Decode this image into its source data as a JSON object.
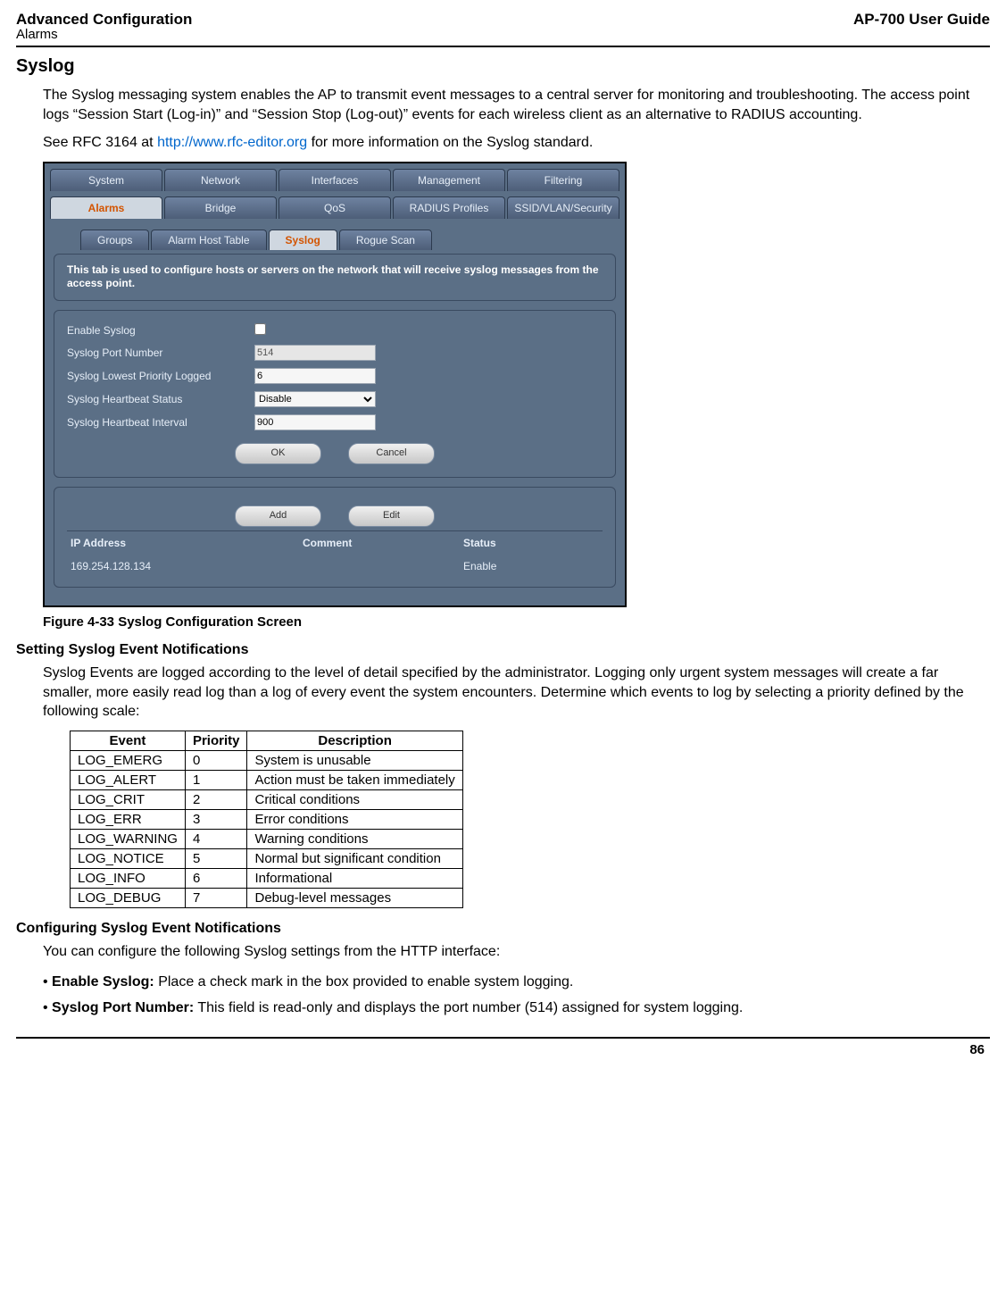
{
  "header": {
    "left_title": "Advanced Configuration",
    "left_sub": "Alarms",
    "right_title": "AP-700 User Guide"
  },
  "section_title": "Syslog",
  "intro_p1": "The Syslog messaging system enables the AP to transmit event messages to a central server for monitoring and troubleshooting. The access point logs “Session Start (Log-in)” and “Session Stop (Log-out)” events for each wireless client as an alternative to RADIUS accounting.",
  "intro_p2a": "See RFC 3164 at ",
  "intro_link": "http://www.rfc-editor.org",
  "intro_p2b": " for more information on the Syslog standard.",
  "ui": {
    "main_tabs": [
      "System",
      "Network",
      "Interfaces",
      "Management",
      "Filtering"
    ],
    "main_tabs2": [
      "Alarms",
      "Bridge",
      "QoS",
      "RADIUS Profiles",
      "SSID/VLAN/Security"
    ],
    "main_tabs2_active": 0,
    "sub_tabs": [
      "Groups",
      "Alarm Host Table",
      "Syslog",
      "Rogue Scan"
    ],
    "sub_tabs_active": 2,
    "panel_desc": "This tab is used to configure hosts or servers on the network that will receive syslog messages from the access point.",
    "form": {
      "enable_label": "Enable Syslog",
      "port_label": "Syslog Port Number",
      "port_value": "514",
      "priority_label": "Syslog Lowest Priority Logged",
      "priority_value": "6",
      "hb_status_label": "Syslog Heartbeat Status",
      "hb_status_value": "Disable",
      "hb_interval_label": "Syslog Heartbeat Interval",
      "hb_interval_value": "900"
    },
    "buttons": {
      "ok": "OK",
      "cancel": "Cancel",
      "add": "Add",
      "edit": "Edit"
    },
    "host_table": {
      "headers": {
        "ip": "IP Address",
        "comment": "Comment",
        "status": "Status"
      },
      "rows": [
        {
          "ip": "169.254.128.134",
          "comment": "",
          "status": "Enable"
        }
      ]
    }
  },
  "figure_caption": "Figure 4-33 Syslog Configuration Screen",
  "setting_title": "Setting Syslog Event Notifications",
  "setting_p": "Syslog Events are logged according to the level of detail specified by the administrator. Logging only urgent system messages will create a far smaller, more easily read log than a log of every event the system encounters. Determine which events to log by selecting a priority defined by the following scale:",
  "priority_table": {
    "headers": [
      "Event",
      "Priority",
      "Description"
    ],
    "rows": [
      [
        "LOG_EMERG",
        "0",
        "System is unusable"
      ],
      [
        "LOG_ALERT",
        "1",
        "Action must be taken immediately"
      ],
      [
        "LOG_CRIT",
        "2",
        "Critical conditions"
      ],
      [
        "LOG_ERR",
        "3",
        "Error conditions"
      ],
      [
        "LOG_WARNING",
        "4",
        "Warning conditions"
      ],
      [
        "LOG_NOTICE",
        "5",
        "Normal but significant condition"
      ],
      [
        "LOG_INFO",
        "6",
        "Informational"
      ],
      [
        "LOG_DEBUG",
        "7",
        "Debug-level messages"
      ]
    ]
  },
  "config_title": "Configuring Syslog Event Notifications",
  "config_intro": "You can configure the following Syslog settings from the HTTP interface:",
  "bullets": [
    {
      "bold": "Enable Syslog:",
      "rest": " Place a check mark in the box provided to enable system logging."
    },
    {
      "bold": "Syslog Port Number:",
      "rest": " This field is read-only and displays the port number (514) assigned for system logging."
    }
  ],
  "page_number": "86"
}
